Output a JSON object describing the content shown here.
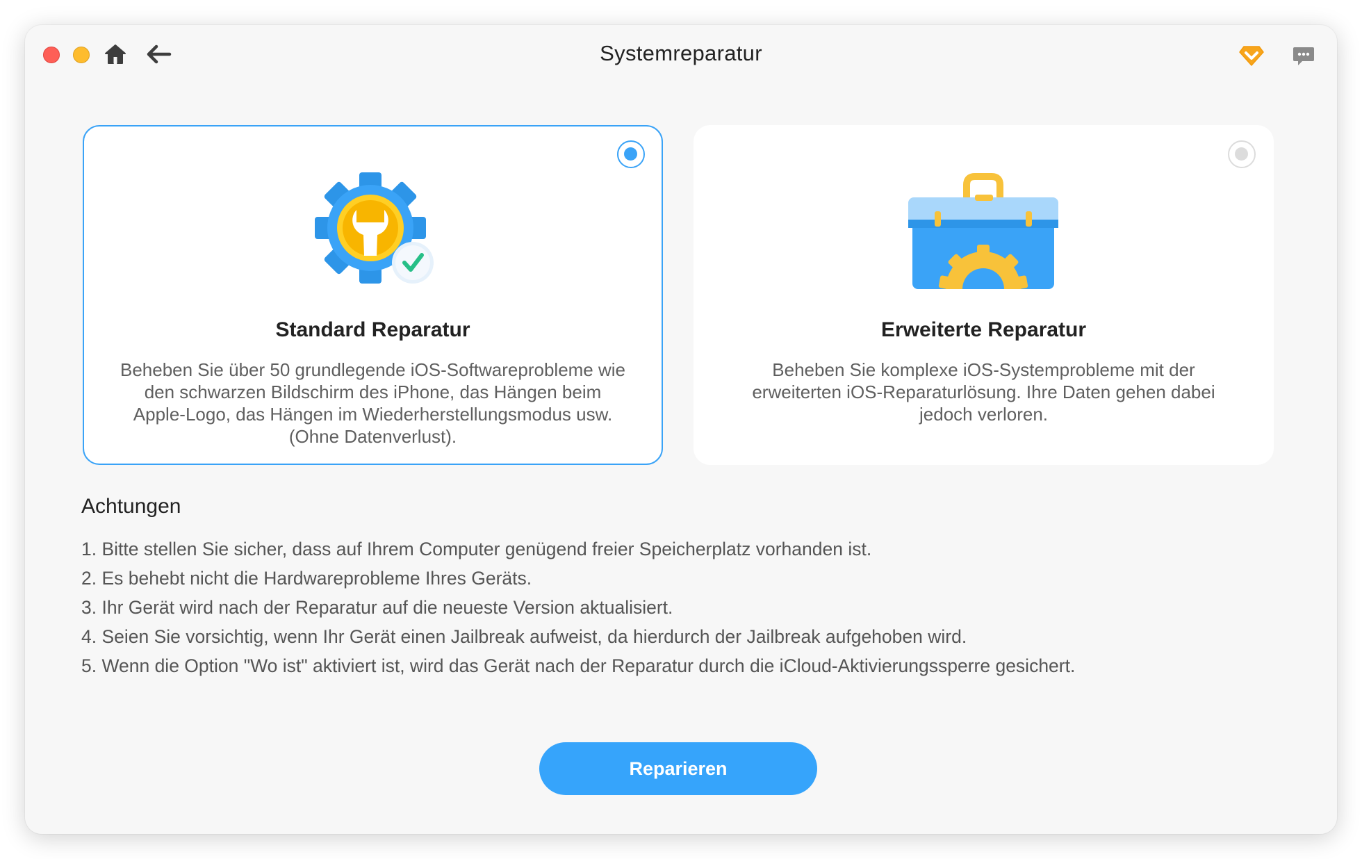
{
  "window": {
    "title": "Systemreparatur"
  },
  "toolbar": {
    "left_icons": [
      "home-icon",
      "back-arrow-icon"
    ],
    "right_icons": [
      "premium-diamond-icon",
      "feedback-chat-icon"
    ]
  },
  "options": [
    {
      "title": "Standard Reparatur",
      "description": "Beheben Sie über 50 grundlegende iOS-Softwareprobleme wie den schwarzen Bildschirm des iPhone, das Hängen beim Apple-Logo, das Hängen im Wiederherstellungsmodus usw. (Ohne Datenverlust).",
      "icon": "gear-wrench-check-icon",
      "selected": true
    },
    {
      "title": "Erweiterte Reparatur",
      "description": "Beheben Sie komplexe iOS-Systemprobleme mit der erweiterten iOS-Reparaturlösung. Ihre Daten gehen dabei jedoch verloren.",
      "icon": "toolbox-gear-icon",
      "selected": false
    }
  ],
  "notes": {
    "title": "Achtungen",
    "items": [
      "1. Bitte stellen Sie sicher, dass auf Ihrem Computer genügend freier Speicherplatz vorhanden ist.",
      "2. Es behebt nicht die Hardwareprobleme Ihres Geräts.",
      "3. Ihr Gerät wird nach der Reparatur auf die neueste Version aktualisiert.",
      "4. Seien Sie vorsichtig, wenn Ihr Gerät einen Jailbreak aufweist, da hierdurch der Jailbreak aufgehoben wird.",
      "5. Wenn die Option \"Wo ist\" aktiviert ist, wird das Gerät nach der Reparatur durch die iCloud-Aktivierungssperre gesichert."
    ]
  },
  "action": {
    "label": "Reparieren"
  },
  "colors": {
    "accent": "#36a4fb",
    "selected_border": "#3aa3f7",
    "premium": "#f5a623",
    "close": "#fe5f57",
    "minimize": "#febc2e"
  }
}
